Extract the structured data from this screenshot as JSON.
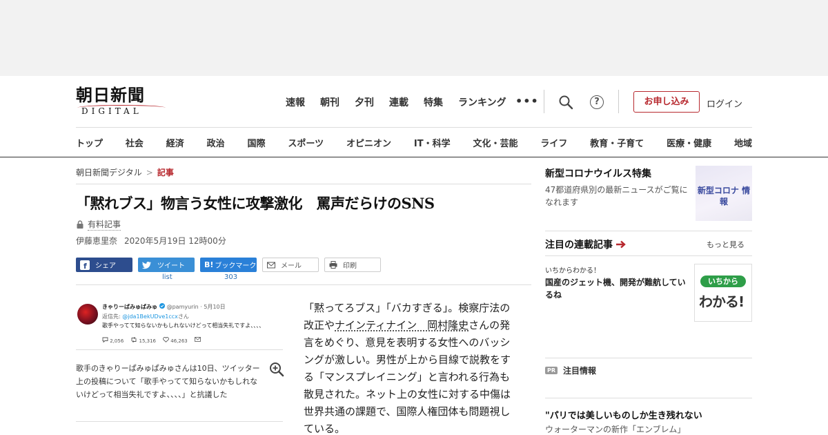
{
  "header": {
    "logo_main": "朝日新聞",
    "logo_sub": "DIGITAL",
    "top_nav": [
      "速報",
      "朝刊",
      "夕刊",
      "連載",
      "特集",
      "ランキング"
    ],
    "more_dots": "•••",
    "help_glyph": "?",
    "apply_label": "お申し込み",
    "login_label": "ログイン"
  },
  "category_nav": [
    "トップ",
    "社会",
    "経済",
    "政治",
    "国際",
    "スポーツ",
    "オピニオン",
    "IT・科学",
    "文化・芸能",
    "ライフ",
    "教育・子育て",
    "医療・健康",
    "地域"
  ],
  "breadcrumb": {
    "home": "朝日新聞デジタル",
    "sep": ">",
    "current": "記事"
  },
  "article": {
    "headline": "「黙れブス」物言う女性に攻撃激化　罵声だらけのSNS",
    "paid_label": "有料記事",
    "author": "伊藤恵里奈",
    "date": "2020年5月19日 12時00分",
    "body_parts": [
      "「黙ってろブス」「バカすぎる」。検察庁法の改正や",
      "ナインティナイン　岡村隆史",
      "さんの発言をめぐり、意見を表明する女性へのバッシングが激しい。男性が上から目線で説教をする「マンスプレイニング」と言われる行為も散見された。ネット上の女性に対する中傷は世界共通の課題で、国際人権団体も問題視している。"
    ]
  },
  "share": {
    "facebook": "シェア",
    "twitter": "ツイート",
    "hatena": "ブックマーク",
    "hatena_icon": "B!",
    "mail": "メール",
    "print": "印刷",
    "twitter_count": "list",
    "hatena_count": "303"
  },
  "tweet": {
    "name": "きゃりーぱみゅぱみゅ",
    "handle": "@pamyurin · 5月10日",
    "reply_prefix": "返信先:",
    "reply_to": "@jda1BekUDve1ccx",
    "reply_suffix": "さん",
    "text": "歌手やってて知らないかもしれないけどって相当失礼ですよ、、、、",
    "replies": "2,056",
    "retweets": "15,316",
    "likes": "46,263"
  },
  "caption": "歌手のきゃりーぱみゅぱみゅさんは10日、ツイッター上の投稿について「歌手やってて知らないかもしれないけどって相当失礼ですよ、、、、」と抗議した",
  "sidebar": {
    "corona_title": "新型コロナウイルス特集",
    "corona_desc": "47都道府県別の最新ニュースがご覧になれます",
    "corona_img_text": "新型コロナ 情報",
    "serial_title": "注目の連載記事",
    "more_link": "もっと見る",
    "serial_kicker": "いちからわかる！",
    "serial_item": "国産のジェット機、開発が難航しているね",
    "wakaru_pill": "いちから",
    "wakaru_big": "わかる!",
    "pr_badge": "PR",
    "pr_title": "注目情報",
    "pr_headline": "\"パリでは美しいものしか生き残れない",
    "pr_sub": "ウォーターマンの新作「エンブレム」"
  },
  "colors": {
    "brand_red": "#b7282e",
    "facebook": "#2d4d8e",
    "twitter": "#3a8fd6",
    "hatena": "#2a80d8"
  }
}
